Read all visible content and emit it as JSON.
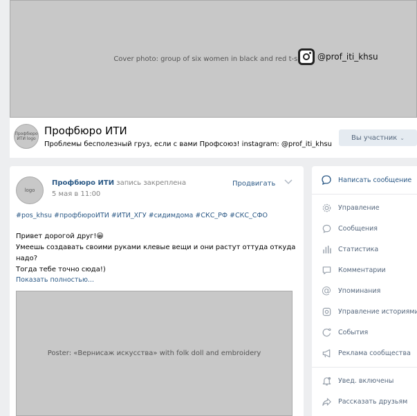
{
  "cover": {
    "image_label": "Cover photo: group of six women in black and red t-shirts",
    "instagram_handle": "@prof_iti_khsu"
  },
  "group": {
    "avatar_label": "Профбюро ИТИ logo",
    "name": "Профбюро ИТИ",
    "status": "Проблемы бесполезный груз, если с вами Профсоюз! instagram: @prof_iti_khsu",
    "member_button": "Вы участник"
  },
  "post": {
    "avatar_label": "logo",
    "author": "Профбюро ИТИ",
    "author_note": "запись закреплена",
    "date": "5 мая в 11:00",
    "promote": "Продвигать",
    "hashtags": "#pos_khsu #профбюроИТИ #ИТИ_ХГУ #сидимдома #СКС_РФ #СКС_СФО",
    "text_line1": "Привет дорогой друг!😀",
    "text_line2": "Умеешь создавать своими руками клевые вещи и они растут оттуда откуда надо?",
    "text_line3": "Тогда тебе точно сюда!)",
    "show_more": "Показать полностью...",
    "image_label": "Poster: «Вернисаж искусства» with folk doll and embroidery"
  },
  "sidebar": {
    "items": [
      {
        "label": "Написать сообщение",
        "icon": "message-icon"
      },
      {
        "label": "Управление",
        "icon": "gear-icon"
      },
      {
        "label": "Сообщения",
        "icon": "chat-bubble-icon"
      },
      {
        "label": "Статистика",
        "icon": "stats-icon"
      },
      {
        "label": "Комментарии",
        "icon": "comment-icon"
      },
      {
        "label": "Упоминания",
        "icon": "mention-icon"
      },
      {
        "label": "Управление историями",
        "icon": "stories-icon"
      },
      {
        "label": "События",
        "icon": "event-icon"
      },
      {
        "label": "Реклама сообщества",
        "icon": "megaphone-icon"
      },
      {
        "label": "Увед. включены",
        "icon": "bell-icon"
      },
      {
        "label": "Рассказать друзьям",
        "icon": "share-icon"
      }
    ]
  },
  "colors": {
    "link": "#2a5885",
    "muted": "#828282",
    "page_bg": "#edeef0",
    "icon": "#99a2ad"
  }
}
